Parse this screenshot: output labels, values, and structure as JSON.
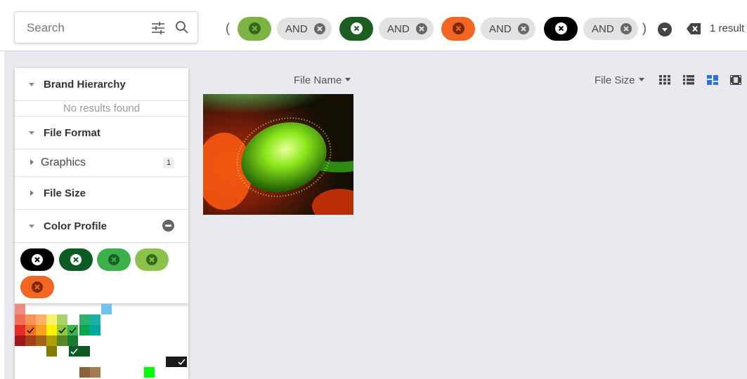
{
  "search": {
    "placeholder": "Search"
  },
  "filter_bar": {
    "open_paren": "(",
    "close_paren": ")",
    "and_label": "AND",
    "chips": [
      {
        "color": "#7cb342",
        "x_color": "#33691e"
      },
      {
        "color": "#1b5e20",
        "x_color": "#ffffff"
      },
      {
        "color": "#f26522",
        "x_color": "#7a2a00"
      },
      {
        "color": "#000000",
        "x_color": "#ffffff"
      }
    ],
    "results_text": "1 result"
  },
  "sidebar": {
    "sections": [
      {
        "title": "Brand Hierarchy",
        "expanded": true,
        "empty_text": "No results found"
      },
      {
        "title": "File Format",
        "expanded": true,
        "items": [
          {
            "label": "Graphics",
            "count": "1"
          }
        ]
      },
      {
        "title": "File Size",
        "expanded": false
      },
      {
        "title": "Color Profile",
        "expanded": true
      }
    ],
    "color_chips": [
      {
        "color": "#000000",
        "x_color": "#ffffff"
      },
      {
        "color": "#0b5c22",
        "x_color": "#ffffff"
      },
      {
        "color": "#3cb04a",
        "x_color": "#1b5e20"
      },
      {
        "color": "#8bc34a",
        "x_color": "#33691e"
      },
      {
        "color": "#f26522",
        "x_color": "#7a2a00"
      }
    ]
  },
  "content": {
    "sort_name_label": "File Name",
    "sort_size_label": "File Size",
    "view_modes": [
      "grid-view-icon",
      "list-view-icon",
      "masonry-view-icon",
      "filmstrip-view-icon"
    ],
    "active_view": "masonry-view-icon",
    "file": {
      "kind": "image",
      "subject": "green fuzzy poppy bud on red background"
    }
  }
}
